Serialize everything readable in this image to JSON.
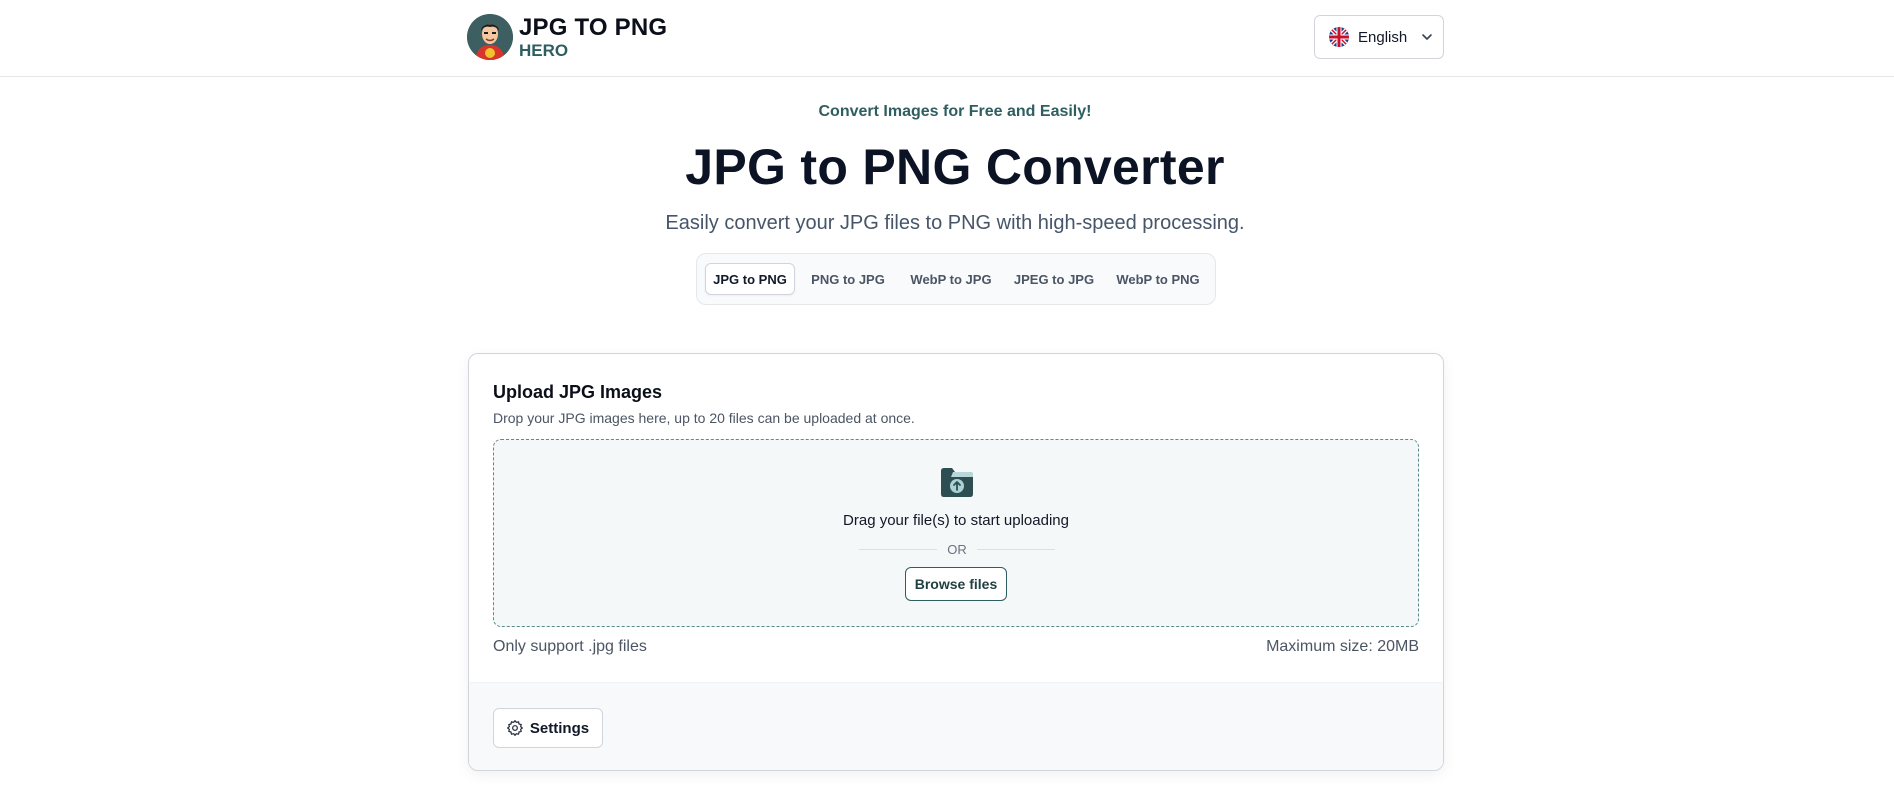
{
  "header": {
    "logo_title": "JPG TO PNG",
    "logo_subtitle": "HERO",
    "language": {
      "label": "English",
      "flag_icon": "uk-flag-icon",
      "chevron_icon": "chevron-down-icon"
    }
  },
  "hero": {
    "tagline": "Convert Images for Free and Easily!",
    "title": "JPG to PNG Converter",
    "subtitle": "Easily convert your JPG files to PNG with high-speed processing."
  },
  "tabs": [
    {
      "label": "JPG to PNG",
      "active": true
    },
    {
      "label": "PNG to JPG",
      "active": false
    },
    {
      "label": "WebP to JPG",
      "active": false
    },
    {
      "label": "JPEG to JPG",
      "active": false
    },
    {
      "label": "WebP to PNG",
      "active": false
    }
  ],
  "upload": {
    "title": "Upload JPG Images",
    "description": "Drop your JPG images here, up to 20 files can be uploaded at once.",
    "drag_text": "Drag your file(s) to start uploading",
    "or_text": "OR",
    "browse_label": "Browse files",
    "support_text": "Only support .jpg files",
    "max_size_text": "Maximum size: 20MB",
    "icon": "folder-upload-icon"
  },
  "settings": {
    "label": "Settings",
    "icon": "gear-icon"
  },
  "colors": {
    "accent": "#2f5e60",
    "dropzone_bg": "#f4f8f8",
    "title": "#0b1324"
  }
}
